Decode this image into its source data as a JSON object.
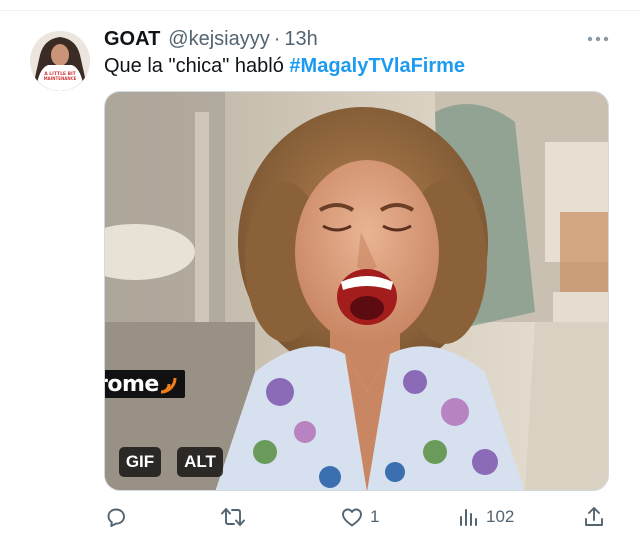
{
  "tweet": {
    "display_name": "GOAT",
    "handle": "@kejsiayyy",
    "separator": "·",
    "time": "13h",
    "text_prefix": "Que la \"chica\" habló ",
    "hashtag": "#MagalyTVlaFirme",
    "avatar_shirt_text": "A LITTLE BIT MAINTENANCE"
  },
  "media": {
    "watermark": "trome",
    "gif_badge": "GIF",
    "alt_badge": "ALT"
  },
  "actions": {
    "reply_count": "",
    "retweet_count": "",
    "like_count": "1",
    "views_count": "102"
  },
  "icons": [
    "more-icon",
    "reply-icon",
    "retweet-icon",
    "like-icon",
    "views-icon",
    "share-icon"
  ],
  "colors": {
    "link": "#1d9bf0",
    "muted": "#536471",
    "text": "#0f1419"
  }
}
